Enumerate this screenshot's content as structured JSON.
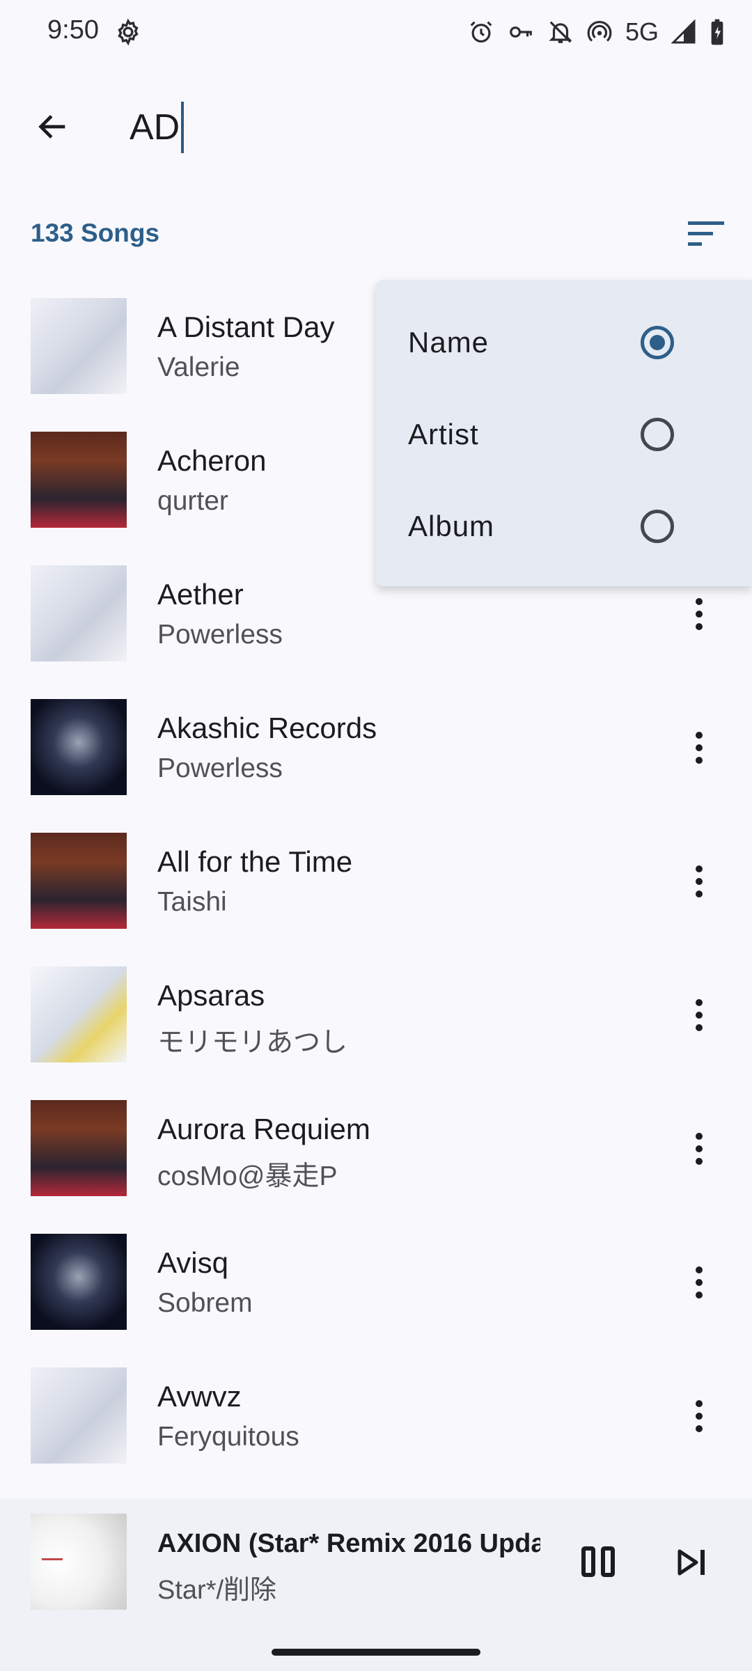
{
  "status_bar": {
    "time": "9:50",
    "network": "5G",
    "icons": [
      "settings-icon",
      "alarm-icon",
      "vpn-key-icon",
      "notifications-off-icon",
      "hotspot-icon",
      "signal-icon",
      "battery-charging-icon"
    ]
  },
  "search": {
    "query": "AD"
  },
  "header": {
    "count_label": "133 Songs"
  },
  "songs": [
    {
      "title": "A Distant Day",
      "artist": "Valerie",
      "art": "art-a"
    },
    {
      "title": "Acheron",
      "artist": "qurter",
      "art": "art-b"
    },
    {
      "title": "Aether",
      "artist": "Powerless",
      "art": "art-a"
    },
    {
      "title": "Akashic Records",
      "artist": "Powerless",
      "art": "art-c"
    },
    {
      "title": "All for the Time",
      "artist": "Taishi",
      "art": "art-b"
    },
    {
      "title": "Apsaras",
      "artist": "モリモリあつし",
      "art": "art-d"
    },
    {
      "title": "Aurora Requiem",
      "artist": "cosMo@暴走P",
      "art": "art-b"
    },
    {
      "title": "Avisq",
      "artist": "Sobrem",
      "art": "art-c"
    },
    {
      "title": "Avwvz",
      "artist": "Feryquitous",
      "art": "art-a"
    }
  ],
  "sort_menu": {
    "options": [
      {
        "label": "Name",
        "selected": true
      },
      {
        "label": "Artist",
        "selected": false
      },
      {
        "label": "Album",
        "selected": false
      }
    ]
  },
  "now_playing": {
    "title": "AXION (Star* Remix 2016 Upda",
    "artist": "Star*/削除",
    "state": "playing"
  },
  "colors": {
    "accent": "#2d5f8a",
    "background": "#f9f9fd",
    "menu_background": "#e6eaf2",
    "player_background": "#eff1f6"
  }
}
